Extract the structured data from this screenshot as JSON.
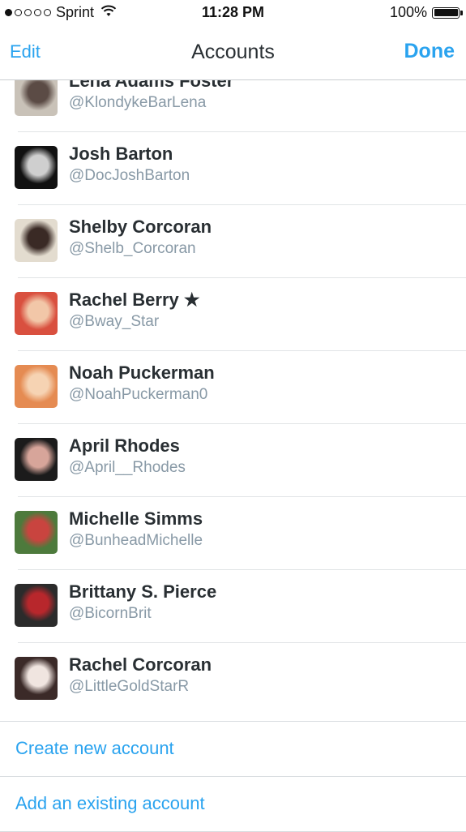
{
  "status_bar": {
    "carrier": "Sprint",
    "time": "11:28 PM",
    "battery": "100%",
    "signal_bars_filled": 1,
    "signal_bars_total": 5
  },
  "nav": {
    "edit": "Edit",
    "title": "Accounts",
    "done": "Done"
  },
  "accounts": [
    {
      "name": "Lena Adams Foster",
      "handle": "@KlondykeBarLena",
      "avatar": [
        "#c9c2b8",
        "#5b4b45"
      ]
    },
    {
      "name": "Josh Barton",
      "handle": "@DocJoshBarton",
      "avatar": [
        "#111111",
        "#cfcfcf"
      ]
    },
    {
      "name": "Shelby Corcoran",
      "handle": "@Shelb_Corcoran",
      "avatar": [
        "#e3dccf",
        "#3a2a25"
      ]
    },
    {
      "name": "Rachel Berry ★",
      "handle": "@Bway_Star",
      "avatar": [
        "#d9503f",
        "#f2c7a8"
      ]
    },
    {
      "name": "Noah Puckerman",
      "handle": "@NoahPuckerman0",
      "avatar": [
        "#e58b52",
        "#f6d3b3"
      ]
    },
    {
      "name": "April Rhodes",
      "handle": "@April__Rhodes",
      "avatar": [
        "#1b1b1b",
        "#d7a59a"
      ]
    },
    {
      "name": "Michelle Simms",
      "handle": "@BunheadMichelle",
      "avatar": [
        "#4d7a3c",
        "#c9443f"
      ]
    },
    {
      "name": "Brittany S. Pierce",
      "handle": "@BicornBrit",
      "avatar": [
        "#2b2b2b",
        "#b8272c"
      ]
    },
    {
      "name": "Rachel Corcoran",
      "handle": "@LittleGoldStarR",
      "avatar": [
        "#3b2a28",
        "#f0e5e0"
      ]
    }
  ],
  "actions": {
    "create": "Create new account",
    "add_existing": "Add an existing account"
  },
  "colors": {
    "accent": "#2aa3ef",
    "name_text": "#292f33",
    "handle_text": "#8899a6",
    "separator": "#e1e4e6"
  }
}
